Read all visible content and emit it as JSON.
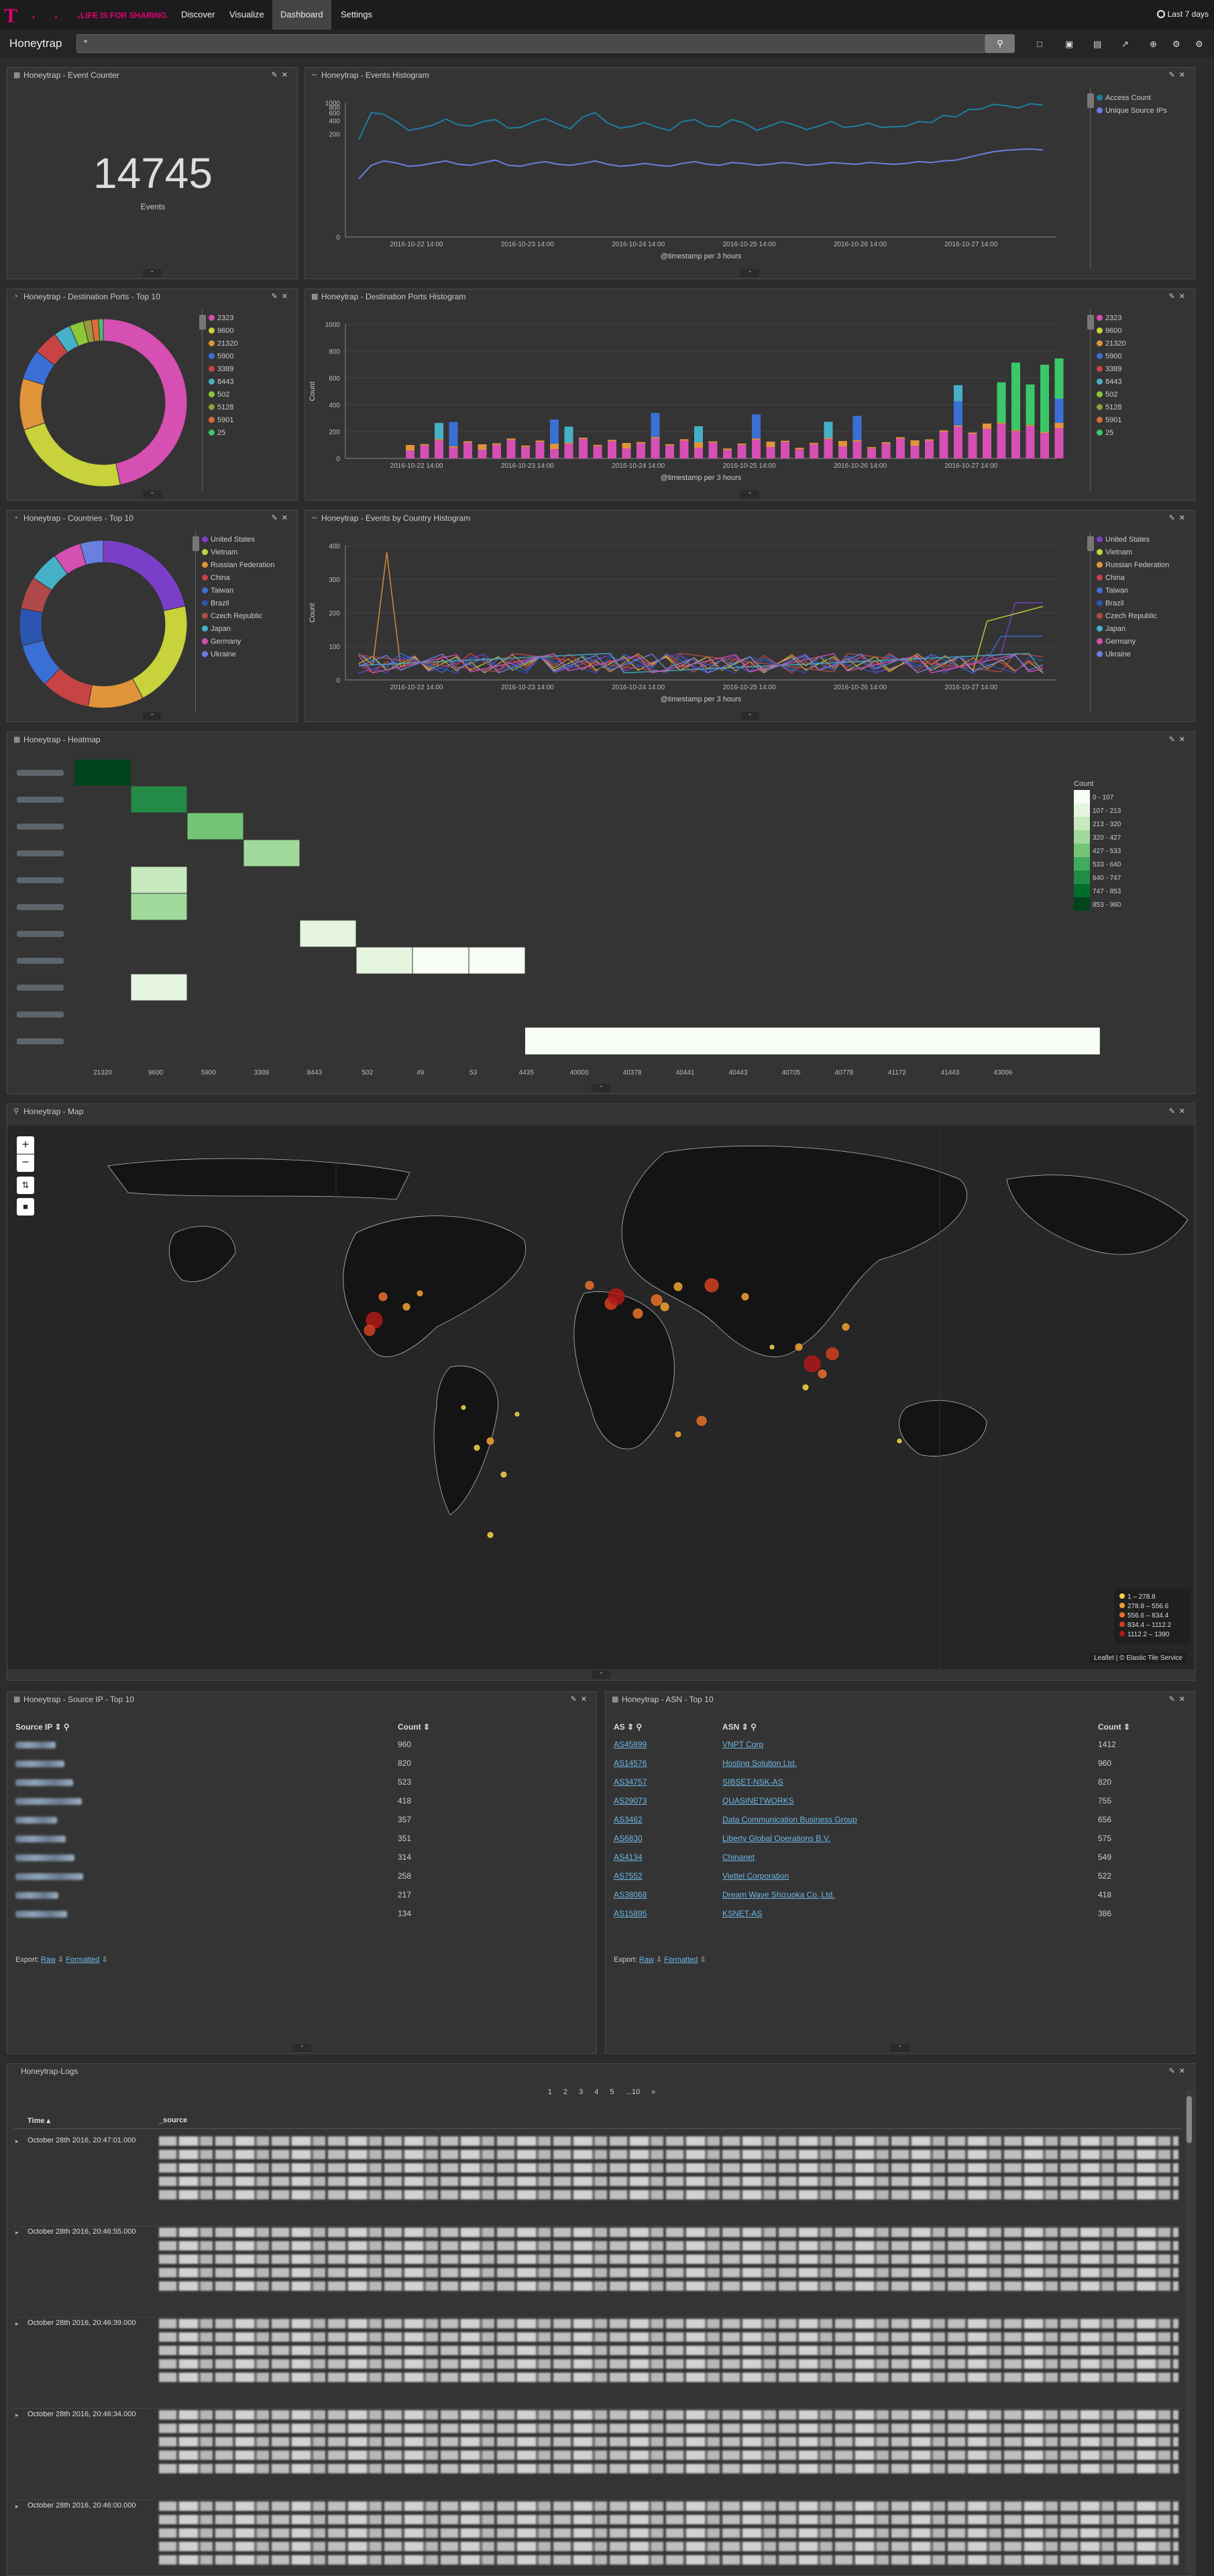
{
  "nav": {
    "logo": "T",
    "dots": "• • •",
    "slogan": "LIFE IS FOR SHARING.",
    "items": [
      "Discover",
      "Visualize",
      "Dashboard",
      "Settings"
    ],
    "active": "Dashboard",
    "timepicker": "Last 7 days"
  },
  "dashboard": {
    "title": "Honeytrap",
    "query": "*",
    "search_icon": "search-icon",
    "toolbar_icons": [
      "new-dashboard-icon",
      "save-icon",
      "open-icon",
      "share-icon",
      "add-icon",
      "settings-icon",
      "gear-icon"
    ]
  },
  "panels": {
    "event_counter": {
      "title": "Honeytrap - Event Counter",
      "value": "14745",
      "label": "Events"
    },
    "events_histogram": {
      "title": "Honeytrap - Events Histogram",
      "xlabel": "@timestamp per 3 hours",
      "ytick_labels": [
        "1000",
        "800",
        "600",
        "400",
        "200",
        "0"
      ],
      "xtick_labels": [
        "2016-10-22 14:00",
        "2016-10-23 14:00",
        "2016-10-24 14:00",
        "2016-10-25 14:00",
        "2016-10-26 14:00",
        "2016-10-27 14:00"
      ],
      "legend": [
        "Access Count",
        "Unique Source IPs"
      ],
      "colors": [
        "#1f7ea1",
        "#6a7fe0"
      ]
    },
    "ports_top10": {
      "title": "Honeytrap - Destination Ports - Top 10",
      "legend": [
        "2323",
        "9600",
        "21320",
        "5900",
        "3389",
        "8443",
        "502",
        "5128",
        "5901",
        "25"
      ],
      "colors": [
        "#d64fb2",
        "#c8d23a",
        "#e0943a",
        "#3a6fd6",
        "#c84444",
        "#46b0c8",
        "#8ac83a",
        "#9a9a3a",
        "#e06a3a",
        "#3ac86a"
      ]
    },
    "ports_histogram": {
      "title": "Honeytrap - Destination Ports Histogram",
      "xlabel": "@timestamp per 3 hours",
      "ylabel": "Count",
      "ytick_labels": [
        "1000",
        "800",
        "600",
        "400",
        "200",
        "0"
      ],
      "xtick_labels": [
        "2016-10-22 14:00",
        "2016-10-23 14:00",
        "2016-10-24 14:00",
        "2016-10-25 14:00",
        "2016-10-26 14:00",
        "2016-10-27 14:00"
      ],
      "legend": [
        "2323",
        "9600",
        "21320",
        "5900",
        "3389",
        "8443",
        "502",
        "5128",
        "5901",
        "25"
      ]
    },
    "countries_top10": {
      "title": "Honeytrap - Countries - Top 10",
      "legend": [
        "United States",
        "Vietnam",
        "Russian Federation",
        "China",
        "Taiwan",
        "Brazil",
        "Czech Republic",
        "Japan",
        "Germany",
        "Ukraine"
      ],
      "colors": [
        "#7a3fc8",
        "#c8d23a",
        "#e0943a",
        "#c84444",
        "#3a6fd6",
        "#2a55b0",
        "#b04a4a",
        "#46b0c8",
        "#d64fb2",
        "#6a7fe0"
      ]
    },
    "country_histogram": {
      "title": "Honeytrap - Events by Country Histogram",
      "xlabel": "@timestamp per 3 hours",
      "ylabel": "Count",
      "ytick_labels": [
        "400",
        "300",
        "200",
        "100",
        "0"
      ],
      "xtick_labels": [
        "2016-10-22 14:00",
        "2016-10-23 14:00",
        "2016-10-24 14:00",
        "2016-10-25 14:00",
        "2016-10-26 14:00",
        "2016-10-27 14:00"
      ]
    },
    "heatmap": {
      "title": "Honeytrap - Heatmap",
      "xlabel": "dest_port: Descending",
      "xtick_labels": [
        "21320",
        "9600",
        "5900",
        "3389",
        "8443",
        "502",
        "49",
        "53",
        "4435",
        "40000",
        "40378",
        "40441",
        "40443",
        "40705",
        "40778",
        "41172",
        "41443",
        "43006"
      ],
      "legend_title": "Count",
      "legend": [
        "0 - 107",
        "107 - 213",
        "213 - 320",
        "320 - 427",
        "427 - 533",
        "533 - 640",
        "640 - 747",
        "747 - 853",
        "853 - 960"
      ],
      "legend_colors": [
        "#f7fcf5",
        "#e5f5e0",
        "#c7e9c0",
        "#a1d99b",
        "#74c476",
        "#41ab5d",
        "#238b45",
        "#006d2c",
        "#00441b"
      ]
    },
    "map": {
      "title": "Honeytrap - Map",
      "legend": [
        "1 – 278.8",
        "278.8 – 556.6",
        "556.6 – 834.4",
        "834.4 – 1112.2",
        "1112.2 – 1390"
      ],
      "legend_colors": [
        "#f6d24a",
        "#f0a030",
        "#e8702a",
        "#d24020",
        "#b01818"
      ],
      "attribution": "Leaflet | © Elastic Tile Service",
      "controls": [
        "zoom-in-icon",
        "zoom-out-icon",
        "fit-bounds-icon",
        "draw-icon"
      ]
    },
    "source_ip": {
      "title": "Honeytrap - Source IP - Top 10",
      "col1": "Source IP",
      "col2": "Count",
      "counts": [
        "960",
        "820",
        "523",
        "418",
        "357",
        "351",
        "314",
        "258",
        "217",
        "134"
      ],
      "export_label": "Export:",
      "raw": "Raw",
      "formatted": "Formatted"
    },
    "asn": {
      "title": "Honeytrap - ASN - Top 10",
      "col1": "AS",
      "col2": "ASN",
      "col3": "Count",
      "rows": [
        [
          "AS45899",
          "VNPT Corp",
          "1412"
        ],
        [
          "AS14576",
          "Hosting Solution Ltd.",
          "960"
        ],
        [
          "AS34757",
          "SIBSET-NSK-AS",
          "820"
        ],
        [
          "AS29073",
          "QUASINETWORKS",
          "755"
        ],
        [
          "AS3462",
          "Data Communication Business Group",
          "656"
        ],
        [
          "AS6830",
          "Liberty Global Operations B.V.",
          "575"
        ],
        [
          "AS4134",
          "Chinanet",
          "549"
        ],
        [
          "AS7552",
          "Viettel Corporation",
          "522"
        ],
        [
          "AS38068",
          "Dream Wave Shizuoka Co.,Ltd.",
          "418"
        ],
        [
          "AS15895",
          "KSNET-AS",
          "386"
        ]
      ],
      "export_label": "Export:",
      "raw": "Raw",
      "formatted": "Formatted"
    },
    "logs": {
      "title": "Honeytrap-Logs",
      "pagination": [
        "1",
        "2",
        "3",
        "4",
        "5",
        "...10",
        "»"
      ],
      "col_time": "Time",
      "col_source": "_source",
      "rows": [
        "October 28th 2016, 20:47:01.000",
        "October 28th 2016, 20:46:55.000",
        "October 28th 2016, 20:46:39.000",
        "October 28th 2016, 20:46:34.000",
        "October 28th 2016, 20:46:00.000"
      ]
    }
  },
  "chart_data": [
    {
      "type": "line",
      "title": "Honeytrap - Events Histogram",
      "xlabel": "@timestamp per 3 hours",
      "ylabel": "",
      "x": [
        "2016-10-22 14:00",
        "2016-10-23 14:00",
        "2016-10-24 14:00",
        "2016-10-25 14:00",
        "2016-10-26 14:00",
        "2016-10-27 14:00"
      ],
      "series": [
        {
          "name": "Access Count",
          "values": [
            150,
            600,
            550,
            380,
            240,
            270,
            320,
            430,
            320,
            300,
            380,
            420,
            270,
            280,
            370,
            440,
            330,
            260,
            480,
            600,
            350,
            270,
            300,
            360,
            280,
            240,
            380,
            420,
            300,
            290,
            420,
            350,
            240,
            300,
            380,
            320,
            250,
            300,
            380,
            280,
            300,
            350,
            280,
            290,
            300,
            380,
            360,
            520,
            480,
            700,
            720,
            920,
            860,
            760,
            950,
            880
          ]
        },
        {
          "name": "Unique Source IPs",
          "values": [
            20,
            40,
            50,
            45,
            38,
            40,
            45,
            50,
            42,
            40,
            46,
            52,
            40,
            38,
            44,
            48,
            42,
            40,
            44,
            50,
            42,
            38,
            40,
            44,
            40,
            38,
            44,
            48,
            42,
            40,
            46,
            44,
            40,
            42,
            46,
            44,
            40,
            42,
            46,
            44,
            42,
            46,
            44,
            42,
            44,
            48,
            46,
            50,
            52,
            60,
            70,
            80,
            86,
            90,
            92,
            88
          ]
        }
      ],
      "yscale": "log-like",
      "ylim": [
        0,
        1000
      ]
    },
    {
      "type": "bar",
      "title": "Honeytrap - Destination Ports Histogram",
      "xlabel": "@timestamp per 3 hours",
      "ylabel": "Count",
      "ylim": [
        0,
        1000
      ],
      "stacked": true
    },
    {
      "type": "pie",
      "title": "Honeytrap - Destination Ports - Top 10",
      "categories": [
        "2323",
        "9600",
        "21320",
        "5900",
        "3389",
        "8443",
        "502",
        "5128",
        "5901",
        "25"
      ],
      "values": [
        6100,
        3000,
        1300,
        750,
        620,
        420,
        360,
        200,
        180,
        120
      ]
    },
    {
      "type": "pie",
      "title": "Honeytrap - Countries - Top 10",
      "categories": [
        "United States",
        "Vietnam",
        "Russian Federation",
        "China",
        "Taiwan",
        "Brazil",
        "Czech Republic",
        "Japan",
        "Germany",
        "Ukraine"
      ],
      "values": [
        2400,
        2300,
        1200,
        1050,
        950,
        800,
        700,
        650,
        600,
        500
      ]
    },
    {
      "type": "line",
      "title": "Honeytrap - Events by Country Histogram",
      "xlabel": "@timestamp per 3 hours",
      "ylabel": "Count",
      "ylim": [
        0,
        400
      ]
    },
    {
      "type": "heatmap",
      "title": "Honeytrap - Heatmap",
      "xlabel": "dest_port: Descending"
    }
  ]
}
